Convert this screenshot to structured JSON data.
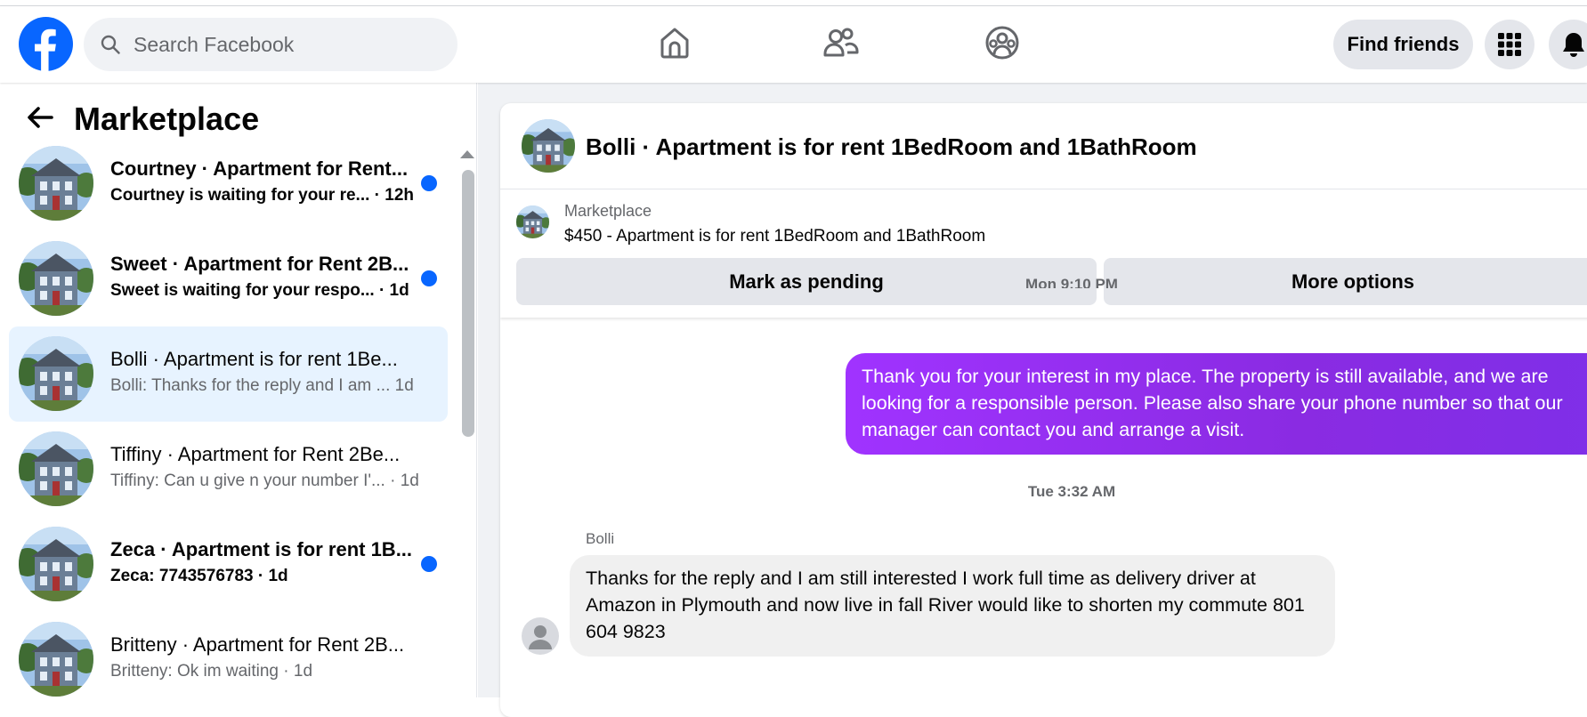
{
  "colors": {
    "brand": "#0866ff",
    "outgoing_bubble": "#8a2be2",
    "active_row": "#e7f3ff",
    "unread_dot": "#0866ff"
  },
  "navbar": {
    "logo_icon": "facebook-logo",
    "search_placeholder": "Search Facebook",
    "nav_icons": [
      "home-icon",
      "friends-icon",
      "groups-icon"
    ],
    "find_friends_label": "Find friends",
    "menu_icon": "grid-menu-icon",
    "notifications_icon": "bell-icon"
  },
  "sidebar": {
    "title": "Marketplace",
    "conversations": [
      {
        "title": "Courtney · Apartment for Rent...",
        "snippet": "Courtney is waiting for your re... · 12h",
        "unread": true,
        "active": false
      },
      {
        "title": "Sweet · Apartment for Rent 2B...",
        "snippet": "Sweet is waiting for your respo... · 1d",
        "unread": true,
        "active": false
      },
      {
        "title": "Bolli · Apartment is for rent 1Be...",
        "snippet": "Bolli: Thanks for the reply and I am ... 1d",
        "unread": false,
        "active": true
      },
      {
        "title": "Tiffiny · Apartment for Rent 2Be...",
        "snippet": "Tiffiny: Can u give n your number I'... · 1d",
        "unread": false,
        "active": false
      },
      {
        "title": "Zeca · Apartment is for rent 1B...",
        "snippet": "Zeca: 7743576783 · 1d",
        "unread": true,
        "active": false
      },
      {
        "title": "Britteny · Apartment for Rent 2B...",
        "snippet": "Britteny: Ok im waiting · 1d",
        "unread": false,
        "active": false
      }
    ]
  },
  "chat": {
    "header_name": "Bolli · Apartment is for rent 1BedRoom and 1BathRoom",
    "listing": {
      "label": "Marketplace",
      "price_title": "$450 - Apartment is for rent 1BedRoom and 1BathRoom",
      "mark_pending_label": "Mark as pending",
      "more_options_label": "More options"
    },
    "timestamp_top": "Mon 9:10 PM",
    "outgoing_message": "Thank you for your interest in my place. The property is still available, and we are looking for a responsible person. Please also share your phone number so that our manager can contact you and arrange a visit.",
    "timestamp_2": "Tue 3:32 AM",
    "incoming_sender": "Bolli",
    "incoming_message": "Thanks for the reply and I am still interested I work full time as delivery driver at Amazon in Plymouth and now live in fall River would like to shorten my commute 801 604 9823"
  }
}
